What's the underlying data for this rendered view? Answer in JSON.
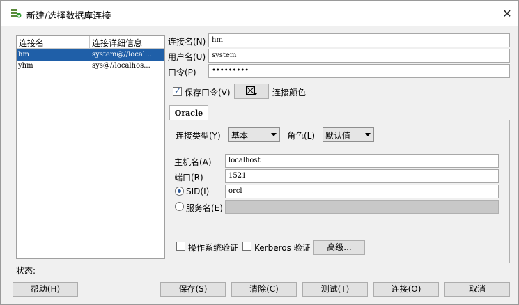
{
  "window": {
    "title": "新建/选择数据库连接"
  },
  "list": {
    "headers": [
      "连接名",
      "连接详细信息"
    ],
    "rows": [
      {
        "name": "hm",
        "detail": "system@//local...",
        "selected": true
      },
      {
        "name": "yhm",
        "detail": "sys@//localhos...",
        "selected": false
      }
    ]
  },
  "form": {
    "conn_name_label": "连接名(N)",
    "conn_name_value": "hm",
    "username_label": "用户名(U)",
    "username_value": "system",
    "password_label": "口令(P)",
    "password_value": "•••••••••",
    "save_password_label": "保存口令(V)",
    "conn_color_label": "连接颜色",
    "tab_label": "Oracle",
    "conn_type_label": "连接类型(Y)",
    "conn_type_value": "基本",
    "role_label": "角色(L)",
    "role_value": "默认值",
    "host_label": "主机名(A)",
    "host_value": "localhost",
    "port_label": "端口(R)",
    "port_value": "1521",
    "sid_label": "SID(I)",
    "sid_value": "orcl",
    "service_label": "服务名(E)",
    "os_auth_label": "操作系统验证",
    "kerberos_label": "Kerberos 验证",
    "advanced_label": "高级..."
  },
  "status_label": "状态:",
  "buttons": {
    "help": "帮助(H)",
    "save": "保存(S)",
    "clear": "清除(C)",
    "test": "测试(T)",
    "connect": "连接(O)",
    "cancel": "取消"
  },
  "state": {
    "save_password_checked": true,
    "sid_selected": true,
    "os_auth_checked": false,
    "kerberos_checked": false
  },
  "colors": {
    "selection": "#1f5fa8",
    "accent": "#2b5797"
  }
}
